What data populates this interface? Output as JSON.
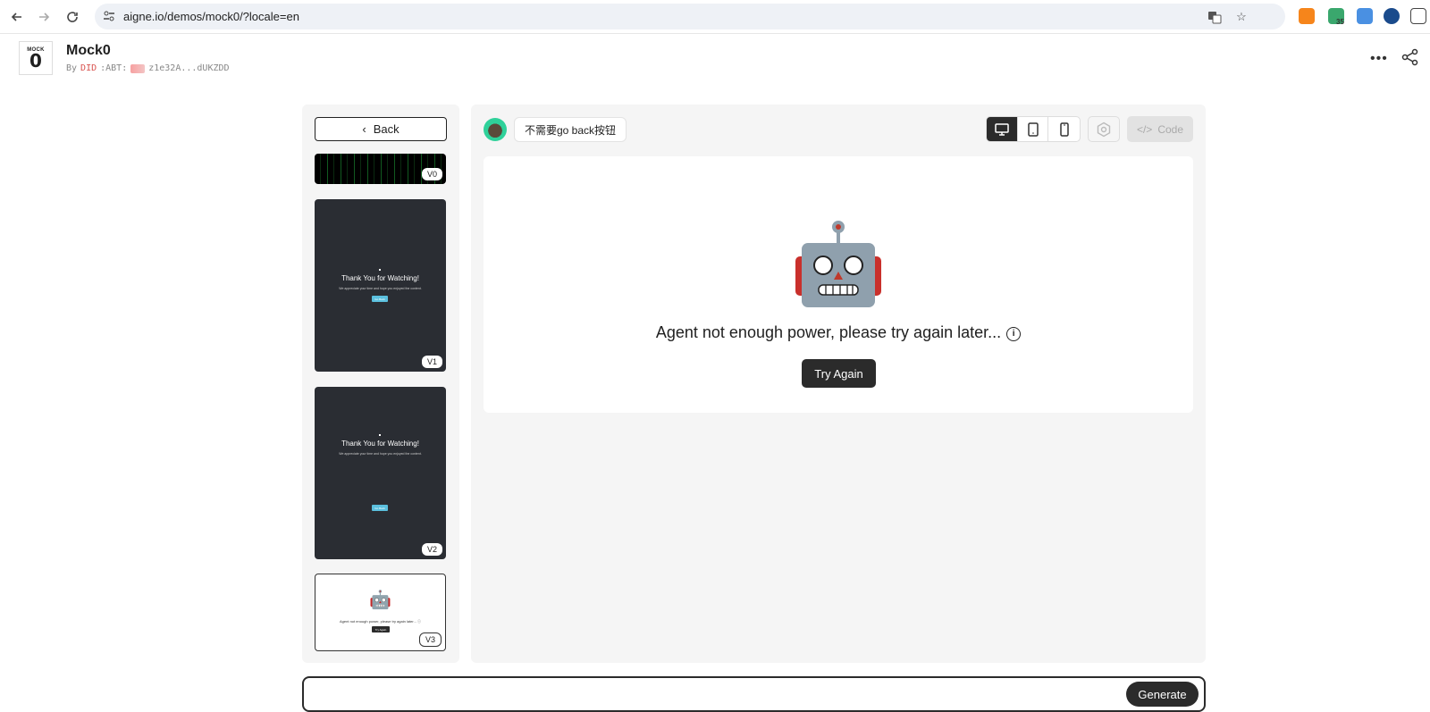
{
  "browser": {
    "url": "aigne.io/demos/mock0/?locale=en",
    "extension_badge": "35"
  },
  "app": {
    "logo_top": "MOCK",
    "logo_digit": "0",
    "title": "Mock0",
    "author_prefix": "By",
    "author_did": "DID",
    "author_abt": ":ABT:",
    "author_addr": "z1e32A...dUKZDD"
  },
  "sidebar": {
    "back_label": "Back",
    "versions": [
      {
        "label": "V0"
      },
      {
        "label": "V1",
        "title": "Thank You for Watching!",
        "subtitle": "We appreciate your time and hope you enjoyed the content.",
        "button": "Go Back"
      },
      {
        "label": "V2",
        "title": "Thank You for Watching!",
        "subtitle": "We appreciate your time and hope you enjoyed the content.",
        "button": "Go Back"
      },
      {
        "label": "V3",
        "message": "Agent not enough power, please try again later... ⓘ",
        "button": "Try Again"
      }
    ]
  },
  "main": {
    "prompt": "不需要go back按钮",
    "device_active": "desktop",
    "code_label": "Code",
    "preview": {
      "robot_glyph": "🤖",
      "error_message": "Agent not enough power, please try again later...",
      "try_again_label": "Try Again"
    }
  },
  "composer": {
    "placeholder": "",
    "generate_label": "Generate"
  },
  "colors": {
    "accent_dark": "#2b2b2b",
    "panel_bg": "#f5f5f5",
    "did_red": "#d9534f"
  }
}
